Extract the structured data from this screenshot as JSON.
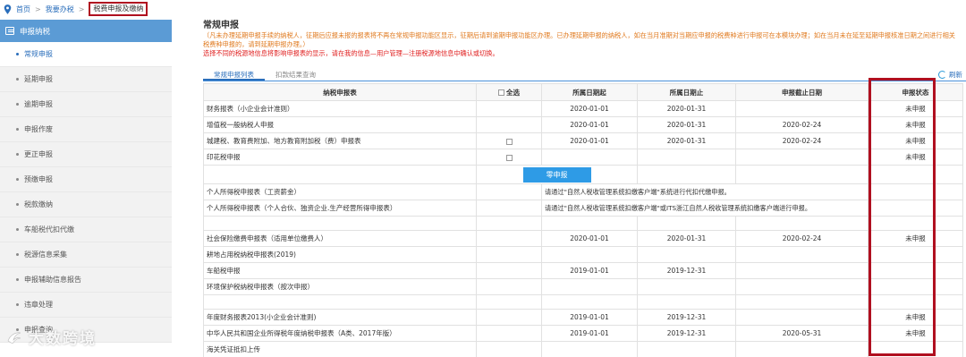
{
  "breadcrumb": {
    "home": "首页",
    "sep1": ">",
    "mine": "我要办税",
    "sep2": ">",
    "current": "税费申报及缴纳"
  },
  "sidebar": {
    "header": "申报纳税",
    "items": [
      {
        "label": "常规申报",
        "active": true
      },
      {
        "label": "延期申报"
      },
      {
        "label": "逾期申报"
      },
      {
        "label": "申报作废"
      },
      {
        "label": "更正申报"
      },
      {
        "label": "预缴申报"
      },
      {
        "label": "税款缴纳"
      },
      {
        "label": "车船税代扣代缴"
      },
      {
        "label": "税源信息采集"
      },
      {
        "label": "申报辅助信息报告"
      },
      {
        "label": "违章处理"
      },
      {
        "label": "申报查询"
      }
    ]
  },
  "main": {
    "title": "常规申报",
    "notice": "（凡未办理延期申报手续的纳税人，征期后应报未报的报表将不再在常规申报功能区显示，征期后请到逾期申报功能区办理。已办理延期申报的纳税人，如在当月准期对当期应申报的税费种进行申报可在本模块办理；如在当月未在延至延期申报核准日期之间进行相关税费种申报的，请到延期申报办理。）",
    "notice_red": "选择不同的税源地信息将影响申报表的显示，请在我的信息—用户管理—注册税源地信息中确认或切换。",
    "tabs": [
      "常规申报列表",
      "扣款结果查询"
    ],
    "refresh": "刷新",
    "table": {
      "headers": [
        "纳税申报表",
        "全选",
        "所属日期起",
        "所属日期止",
        "申报截止日期",
        "申报状态"
      ],
      "rows": [
        {
          "name": "财务报表（小企业会计准则）",
          "checkbox": false,
          "from": "2020-01-01",
          "to": "2020-01-31",
          "deadline": "",
          "status": "未申报"
        },
        {
          "name": "增值税一般纳税人申报",
          "checkbox": false,
          "from": "2020-01-01",
          "to": "2020-01-31",
          "deadline": "2020-02-24",
          "status": "未申报"
        },
        {
          "name": "城建税、教育费附加、地方教育附加税（费）申报表",
          "checkbox": true,
          "from": "2020-01-01",
          "to": "2020-01-31",
          "deadline": "2020-02-24",
          "status": "未申报"
        },
        {
          "name": "印花税申报",
          "checkbox": true,
          "from": "",
          "to": "",
          "deadline": "",
          "status": "未申报"
        }
      ],
      "zero_button": "零申报",
      "rows2": [
        {
          "name": "个人所得税申报表（工资薪金）",
          "note": "请通过\"自然人税收管理系统扣缴客户端\"系统进行代扣代缴申报。"
        },
        {
          "name": "个人所得税申报表（个人合伙、独资企业.生产经营所得申报表）",
          "note": "请通过\"自然人税收管理系统扣缴客户端\"或ITS浙江自然人税收管理系统扣缴客户端进行申报。"
        }
      ],
      "rows3": [
        {
          "name": "社会保险缴费申报表（适用单位缴费人）",
          "from": "2020-01-01",
          "to": "2020-01-31",
          "deadline": "2020-02-24",
          "status": "未申报"
        },
        {
          "name": "耕地占用税纳税申报表(2019)",
          "from": "",
          "to": "",
          "deadline": "",
          "status": ""
        },
        {
          "name": "车船税申报",
          "from": "2019-01-01",
          "to": "2019-12-31",
          "deadline": "",
          "status": ""
        },
        {
          "name": "环境保护税纳税申报表（按次申报）",
          "from": "",
          "to": "",
          "deadline": "",
          "status": ""
        }
      ],
      "rows4": [
        {
          "name": "年度财务报表2013(小企业会计准则)",
          "from": "2019-01-01",
          "to": "2019-12-31",
          "deadline": "",
          "status": "未申报"
        },
        {
          "name": "中华人民共和国企业所得税年度纳税申报表（A类、2017年版）",
          "from": "2019-01-01",
          "to": "2019-12-31",
          "deadline": "2020-05-31",
          "status": "未申报"
        },
        {
          "name": "海关凭证抵扣上传",
          "from": "",
          "to": "",
          "deadline": "",
          "status": ""
        }
      ]
    }
  },
  "watermark": "大数跨境",
  "colors": {
    "sidebar_header": "#5b9bd5",
    "highlight": "#b01020",
    "link": "#2a6ebb",
    "zero_button": "#2e9be6",
    "notice": "#e07a1f"
  }
}
